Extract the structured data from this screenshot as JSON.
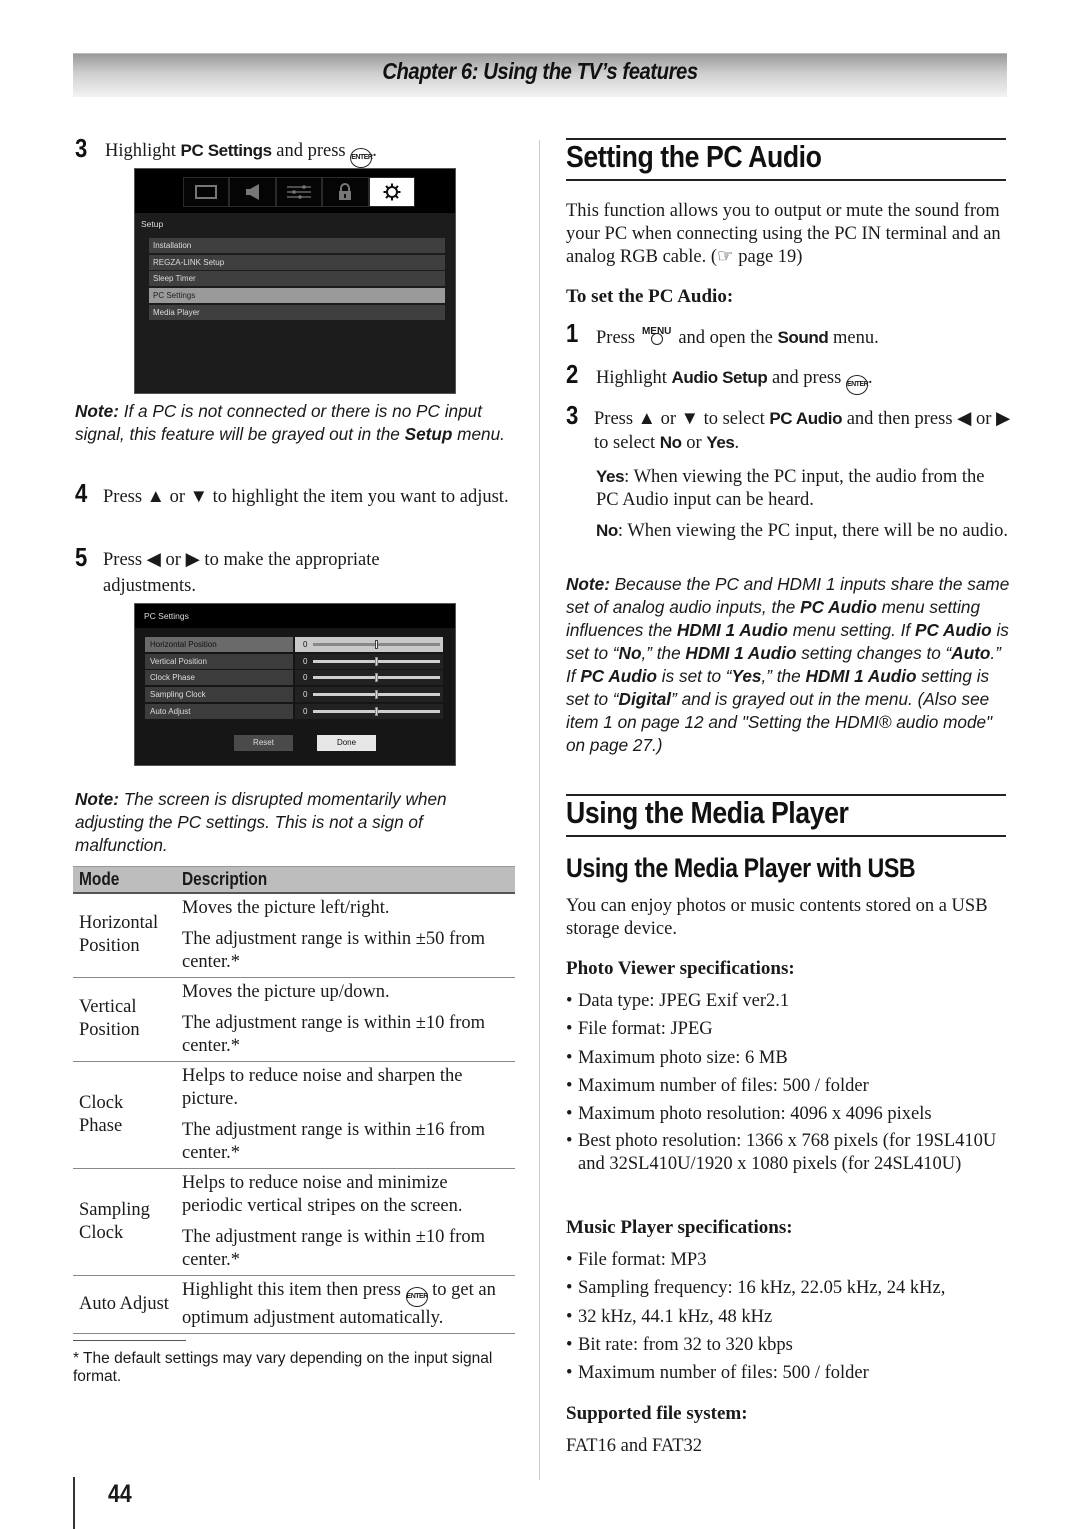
{
  "header": {
    "chapter_title": "Chapter 6: Using the TV’s features"
  },
  "left": {
    "step3": {
      "num": "3",
      "pre": "Highlight ",
      "bold": "PC Settings",
      "post": " and press ",
      "end": "."
    },
    "enter_label": "ENTER",
    "setup_screen": {
      "tabs": [
        "picture-icon",
        "sound-icon",
        "preferences-icon",
        "lock-icon",
        "setup-icon"
      ],
      "active_tab": "setup-icon",
      "title": "Setup",
      "items": [
        {
          "label": "Installation",
          "selected": false
        },
        {
          "label": "REGZA-LINK Setup",
          "selected": false
        },
        {
          "label": "Sleep Timer",
          "selected": false
        },
        {
          "label": "PC Settings",
          "selected": true
        },
        {
          "label": "Media Player",
          "selected": false
        }
      ]
    },
    "note1": {
      "label": "Note:",
      "text1": " If a PC is not connected or there is no PC input signal, this feature will be grayed out in the ",
      "bold": "Setup",
      "text2": " menu."
    },
    "step4": {
      "num": "4",
      "pre": "Press ▲ or ▼ to highlight the item you want to adjust."
    },
    "step5": {
      "num": "5",
      "pre": "Press ◀ or ▶ to make the appropriate adjustments."
    },
    "pc_screen": {
      "title": "PC Settings",
      "rows": [
        {
          "label": "Horizontal Position",
          "value": "0",
          "slider": 0.5,
          "selected": true
        },
        {
          "label": "Vertical Position",
          "value": "0",
          "slider": 0.5,
          "selected": false
        },
        {
          "label": "Clock Phase",
          "value": "0",
          "slider": 0.5,
          "selected": false
        },
        {
          "label": "Sampling Clock",
          "value": "0",
          "slider": 0.5,
          "selected": false
        },
        {
          "label": "Auto Adjust",
          "value": "0",
          "slider": 0.5,
          "selected": false
        }
      ],
      "reset_label": "Reset",
      "done_label": "Done"
    },
    "note2": {
      "label": "Note:",
      "text": " The screen is disrupted momentarily when adjusting the PC settings. This is not a sign of malfunction."
    },
    "table": {
      "headers": [
        "Mode",
        "Description"
      ],
      "rows": [
        {
          "mode": "Horizontal Position",
          "desc": [
            "Moves the picture left/right.",
            "The adjustment range is within ±50 from center.*"
          ]
        },
        {
          "mode": "Vertical Position",
          "desc": [
            "Moves the picture up/down.",
            "The adjustment range is within ±10 from center.*"
          ]
        },
        {
          "mode": "Clock Phase",
          "desc": [
            "Helps to reduce noise and sharpen the picture.",
            "The adjustment range is within ±16 from center.*"
          ]
        },
        {
          "mode": "Sampling Clock",
          "desc": [
            "Helps to reduce noise and minimize periodic vertical stripes on the screen.",
            "The adjustment range is within ±10 from center.*"
          ]
        }
      ],
      "auto_adjust": {
        "mode": "Auto Adjust",
        "pre": "Highlight this item then press ",
        "post": " to get an optimum adjustment automatically."
      }
    },
    "footnote": "* The default settings may vary depending on the input signal format."
  },
  "right": {
    "pc_audio": {
      "title": "Setting the PC Audio",
      "intro": "This function allows you to output or mute the sound from your PC when connecting using the PC IN terminal and an analog RGB cable. (☞ page 19)",
      "howto": "To set the PC Audio:",
      "step1": {
        "num": "1",
        "pre": "Press ",
        "menu_label": "MENU",
        "mid": " and open the ",
        "bold": "Sound",
        "post": " menu."
      },
      "step2": {
        "num": "2",
        "pre": "Highlight ",
        "bold": "Audio Setup",
        "post": " and press ",
        "end": "."
      },
      "step3": {
        "num": "3",
        "pre": "Press ▲ or ▼ to select ",
        "bold": "PC Audio",
        "mid": " and then press ◀ or ▶ to select ",
        "no": "No",
        "or": " or ",
        "yes": "Yes",
        "end": "."
      },
      "yes_desc": {
        "label": "Yes",
        "text": ": When viewing the PC input, the audio from the PC Audio input can be heard."
      },
      "no_desc": {
        "label": "No",
        "text": ": When viewing the PC input, there will be no audio."
      },
      "note": {
        "label": "Note:",
        "parts": [
          {
            "t": " Because the PC and HDMI 1 inputs share the same set of analog audio inputs, the ",
            "b": false
          },
          {
            "t": "PC Audio",
            "b": true
          },
          {
            "t": " menu setting influences the ",
            "b": false
          },
          {
            "t": "HDMI 1 Audio",
            "b": true
          },
          {
            "t": " menu setting. If ",
            "b": false
          },
          {
            "t": "PC Audio",
            "b": true
          },
          {
            "t": " is set to “",
            "b": false
          },
          {
            "t": "No",
            "b": true
          },
          {
            "t": ",” the ",
            "b": false
          },
          {
            "t": "HDMI 1 Audio",
            "b": true
          },
          {
            "t": " setting changes to “",
            "b": false
          },
          {
            "t": "Auto",
            "b": true
          },
          {
            "t": ".” If ",
            "b": false
          },
          {
            "t": "PC Audio",
            "b": true
          },
          {
            "t": " is set to “",
            "b": false
          },
          {
            "t": "Yes",
            "b": true
          },
          {
            "t": ",” the ",
            "b": false
          },
          {
            "t": "HDMI 1 Audio",
            "b": true
          },
          {
            "t": " setting is set to “",
            "b": false
          },
          {
            "t": "Digital",
            "b": true
          },
          {
            "t": "” and is grayed out in the menu. (Also see item 1 on page 12 and \"Setting the HDMI® audio mode\" on page 27.)",
            "b": false
          }
        ]
      }
    },
    "media_player": {
      "title": "Using the Media Player",
      "subtitle": "Using the Media Player with USB",
      "intro": "You can enjoy photos or music contents stored on a USB storage device.",
      "photo_head": "Photo Viewer specifications:",
      "photo_specs": [
        "Data type: JPEG Exif ver2.1",
        "File format: JPEG",
        "Maximum photo size: 6 MB",
        "Maximum number of files: 500 / folder",
        "Maximum photo resolution: 4096 x 4096 pixels",
        "Best photo resolution: 1366 x 768 pixels (for 19SL410U and 32SL410U/1920 x 1080 pixels (for 24SL410U)"
      ],
      "music_head": "Music Player specifications:",
      "music_specs": [
        "File format: MP3",
        "Sampling frequency: 16 kHz, 22.05 kHz, 24 kHz,",
        "32 kHz, 44.1 kHz, 48 kHz",
        "Bit rate: from 32 to 320 kbps",
        "Maximum number of files: 500 / folder"
      ],
      "fs_head": "Supported file system:",
      "fs_value": "FAT16 and FAT32"
    }
  },
  "page_number": "44"
}
